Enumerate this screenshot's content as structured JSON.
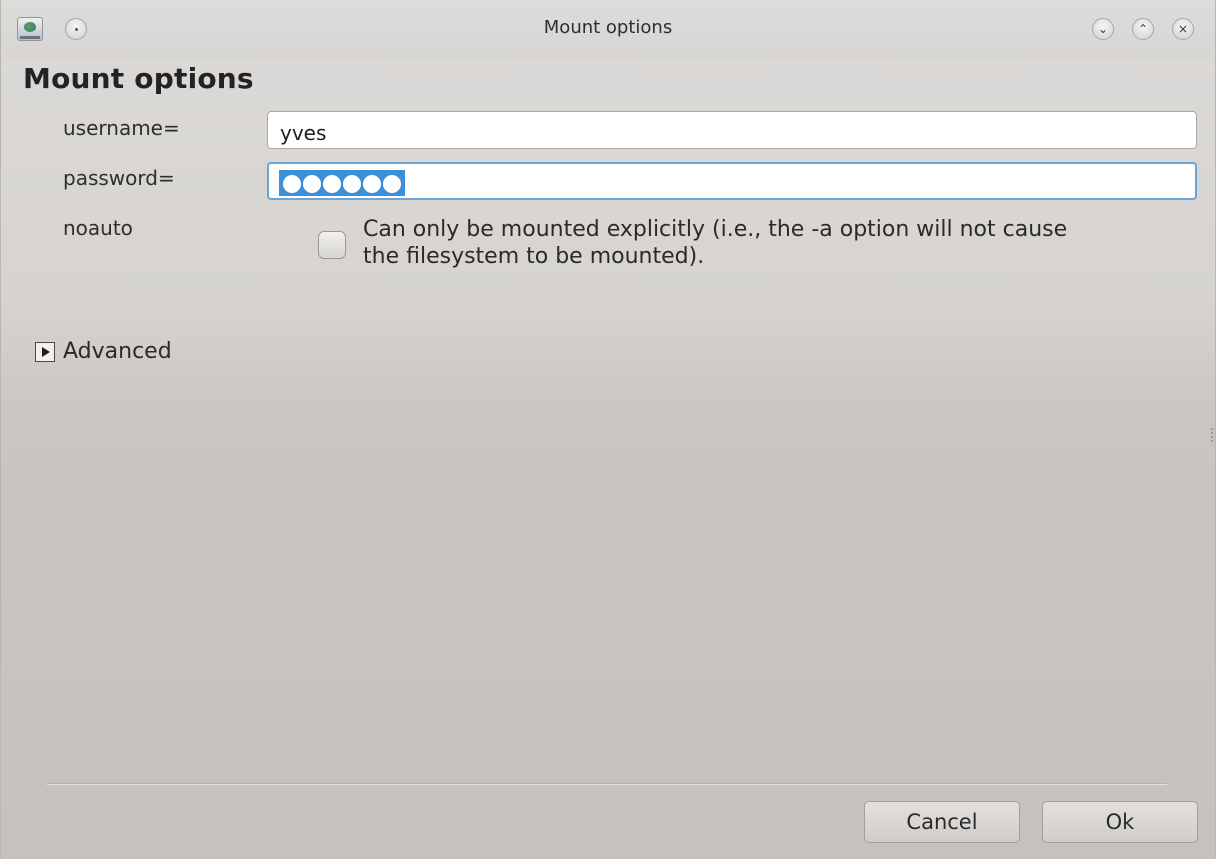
{
  "window": {
    "title": "Mount options"
  },
  "titlebar": {
    "app_icon": "drive-icon",
    "sticky_icon": "pin-icon",
    "minimize_glyph": "⌄",
    "maximize_glyph": "⌃",
    "close_glyph": "×"
  },
  "form": {
    "heading": "Mount options",
    "username_label": "username=",
    "username_value": "yves",
    "password_label": "password=",
    "password_length": 6,
    "password_selected": true,
    "noauto_label": "noauto",
    "noauto_checked": false,
    "noauto_description": "Can only be mounted explicitly (i.e., the -a option will not cause the filesystem to be mounted).",
    "advanced_label": "Advanced",
    "advanced_expanded": false
  },
  "buttons": {
    "cancel": "Cancel",
    "ok": "Ok"
  },
  "colors": {
    "selection": "#3d8fd6",
    "focus_border": "#6aa5d8",
    "window_bg": "#d6d3d0"
  }
}
